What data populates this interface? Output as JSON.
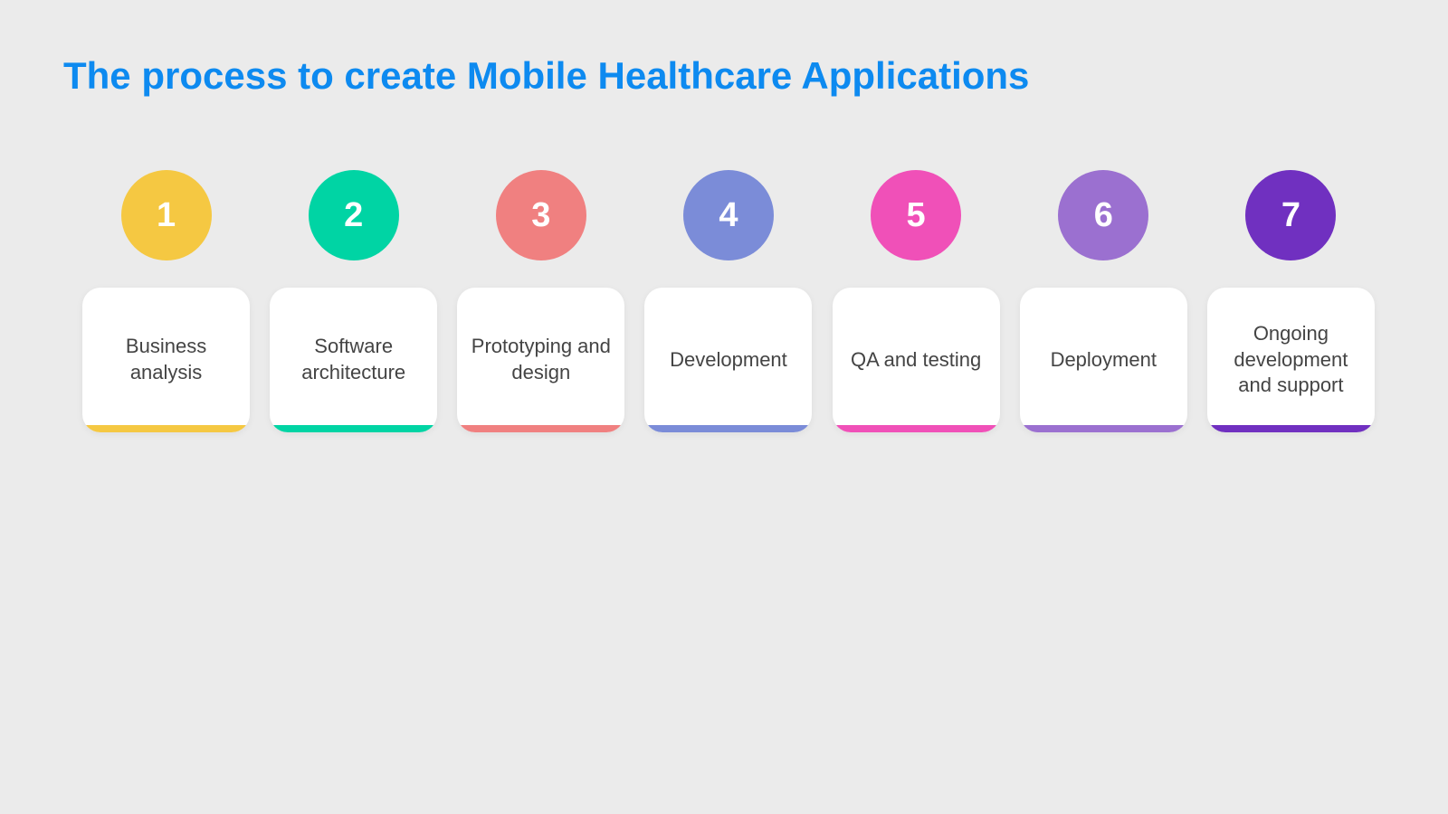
{
  "title": "The process to create Mobile Healthcare Applications",
  "steps": [
    {
      "number": "1",
      "label": "Business analysis",
      "circleColor": "#F5C842",
      "barColor": "#F5C842"
    },
    {
      "number": "2",
      "label": "Software architecture",
      "circleColor": "#00D4A4",
      "barColor": "#00D4A4"
    },
    {
      "number": "3",
      "label": "Prototyping and design",
      "circleColor": "#F08080",
      "barColor": "#F08080"
    },
    {
      "number": "4",
      "label": "Development",
      "circleColor": "#7B8CD8",
      "barColor": "#7B8CD8"
    },
    {
      "number": "5",
      "label": "QA and testing",
      "circleColor": "#F050B8",
      "barColor": "#F050B8"
    },
    {
      "number": "6",
      "label": "Deployment",
      "circleColor": "#9B70D0",
      "barColor": "#9B70D0"
    },
    {
      "number": "7",
      "label": "Ongoing development and support",
      "circleColor": "#7030C0",
      "barColor": "#7030C0"
    }
  ]
}
